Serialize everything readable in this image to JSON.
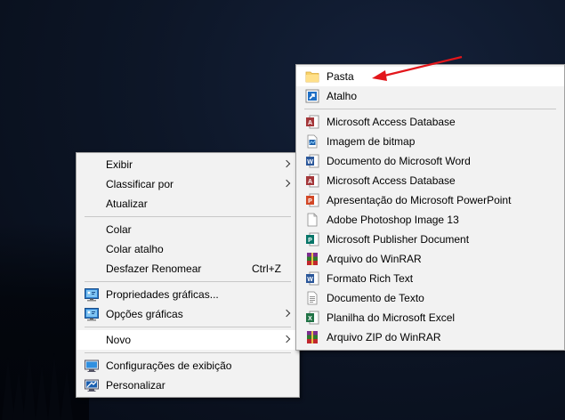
{
  "context_menu": {
    "items": [
      {
        "label": "Exibir",
        "submenu": true
      },
      {
        "label": "Classificar por",
        "submenu": true
      },
      {
        "label": "Atualizar"
      },
      {
        "label": "Colar"
      },
      {
        "label": "Colar atalho"
      },
      {
        "label": "Desfazer Renomear",
        "shortcut": "Ctrl+Z"
      },
      {
        "label": "Propriedades gráficas...",
        "icon": "intel-graphics-icon"
      },
      {
        "label": "Opções gráficas",
        "icon": "intel-graphics-icon",
        "submenu": true
      },
      {
        "label": "Novo",
        "submenu": true,
        "selected": true
      },
      {
        "label": "Configurações de exibição",
        "icon": "display-settings-icon"
      },
      {
        "label": "Personalizar",
        "icon": "personalize-icon"
      }
    ]
  },
  "new_submenu": {
    "items": [
      {
        "label": "Pasta",
        "icon": "folder-icon",
        "highlighted": true
      },
      {
        "label": "Atalho",
        "icon": "shortcut-icon"
      },
      {
        "label": "Microsoft Access Database",
        "icon": "access-icon"
      },
      {
        "label": "Imagem de bitmap",
        "icon": "bitmap-icon"
      },
      {
        "label": "Documento do Microsoft Word",
        "icon": "word-icon"
      },
      {
        "label": "Microsoft Access Database",
        "icon": "access-icon"
      },
      {
        "label": "Apresentação do Microsoft PowerPoint",
        "icon": "powerpoint-icon"
      },
      {
        "label": "Adobe Photoshop Image 13",
        "icon": "blank-file-icon"
      },
      {
        "label": "Microsoft Publisher Document",
        "icon": "publisher-icon"
      },
      {
        "label": "Arquivo do WinRAR",
        "icon": "winrar-icon"
      },
      {
        "label": "Formato Rich Text",
        "icon": "rtf-icon"
      },
      {
        "label": "Documento de Texto",
        "icon": "text-document-icon"
      },
      {
        "label": "Planilha do Microsoft Excel",
        "icon": "excel-icon"
      },
      {
        "label": "Arquivo ZIP do WinRAR",
        "icon": "winrar-zip-icon"
      }
    ]
  },
  "colors": {
    "menu_bg": "#f2f2f2",
    "highlight": "#ffffff",
    "annotation_arrow": "#e3161b"
  }
}
